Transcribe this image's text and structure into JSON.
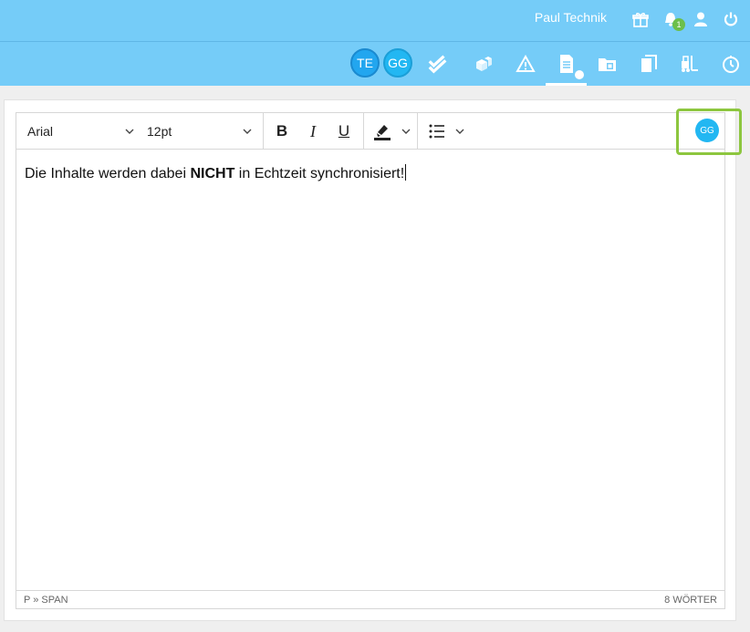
{
  "header": {
    "username": "Paul Technik",
    "notification_count": "1",
    "icons": [
      "gift-icon",
      "bell-icon",
      "user-icon",
      "power-icon"
    ]
  },
  "nav": {
    "avatars": [
      {
        "initials": "TE",
        "color": "#22a6ef"
      },
      {
        "initials": "GG",
        "color": "#22b7f2"
      }
    ],
    "icons": [
      "double-check-icon",
      "boxes-icon",
      "warning-icon",
      "document-icon",
      "folder-icon",
      "copy-icon",
      "forklift-icon",
      "clock-icon"
    ],
    "active_icon": "document-icon"
  },
  "editor": {
    "font_family": "Arial",
    "font_size": "12pt",
    "toolbar": {
      "bold": "B",
      "italic": "I",
      "underline": "U"
    },
    "collaborator_initials": "GG",
    "content_before": "Die Inhalte werden dabei ",
    "content_bold": "NICHT",
    "content_after": " in Echtzeit synchronisiert!",
    "status_path": "P » SPAN",
    "word_count": "8 WÖRTER"
  },
  "colors": {
    "header_bg": "#75ccf8",
    "highlight": "#8dc63f",
    "avatar": "#22b7f2",
    "badge": "#6cbf4b"
  }
}
